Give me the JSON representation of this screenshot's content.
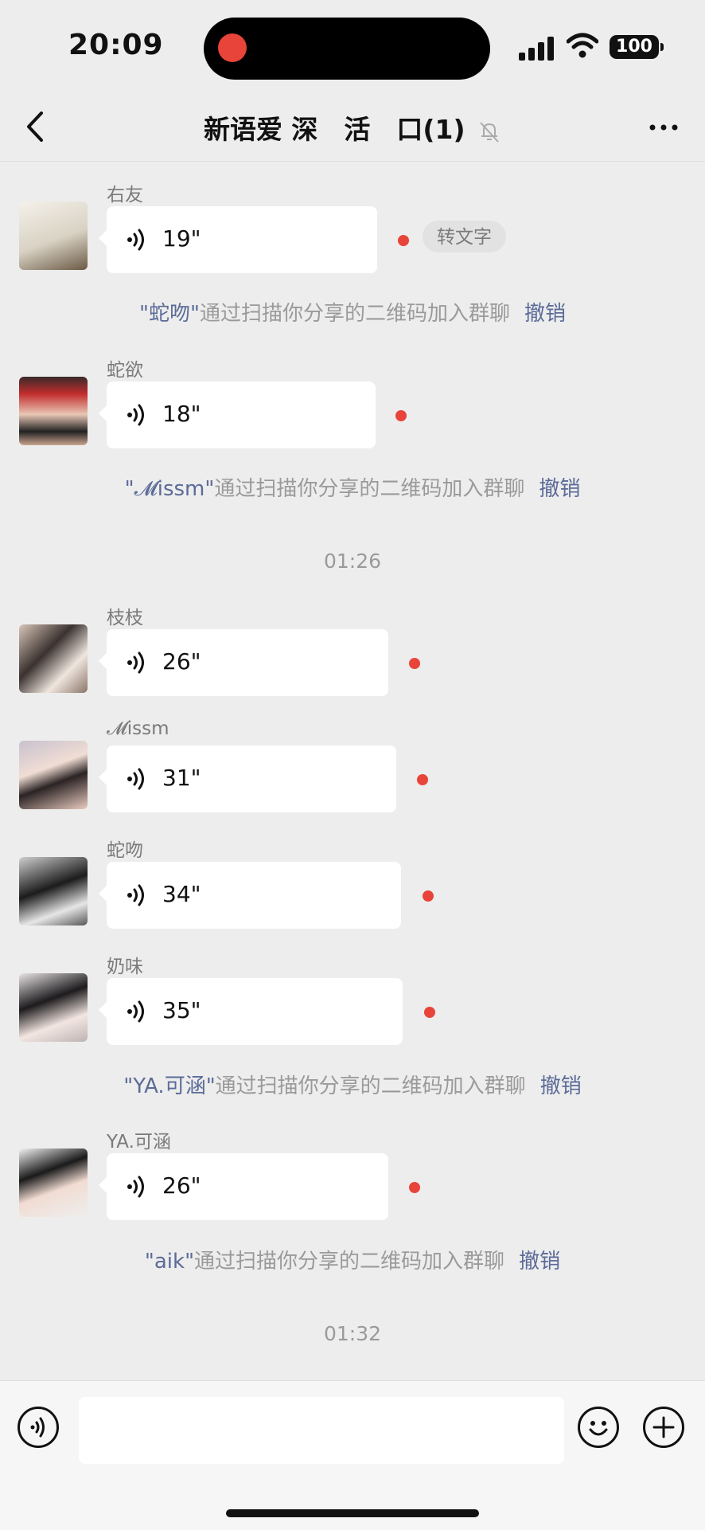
{
  "status_bar": {
    "time": "20:09",
    "battery": "100"
  },
  "nav": {
    "title": "新语爱 深　活　口(1)"
  },
  "messages": [
    {
      "sender": "右友",
      "duration": "19\""
    },
    {
      "sender": "蛇欲",
      "duration": "18\""
    },
    {
      "sender": "枝枝",
      "duration": "26\""
    },
    {
      "sender": "𝓜issm",
      "duration": "31\""
    },
    {
      "sender": "蛇吻",
      "duration": "34\""
    },
    {
      "sender": "奶味",
      "duration": "35\""
    },
    {
      "sender": "YA.可涵",
      "duration": "26\""
    }
  ],
  "to_text_label": "转文字",
  "system_notices": [
    {
      "name": "\"蛇吻\"",
      "text": "通过扫描你分享的二维码加入群聊",
      "action": "撤销"
    },
    {
      "name": "\"𝓜issm\"",
      "text": "通过扫描你分享的二维码加入群聊",
      "action": "撤销"
    },
    {
      "name": "\"YA.可涵\"",
      "text": "通过扫描你分享的二维码加入群聊",
      "action": "撤销"
    },
    {
      "name": "\"aik\"",
      "text": "通过扫描你分享的二维码加入群聊",
      "action": "撤销"
    }
  ],
  "timestamps": [
    "01:26",
    "01:32"
  ],
  "colors": {
    "accent_link": "#5b6b98",
    "unread_dot": "#e8443a",
    "background": "#ededed"
  }
}
